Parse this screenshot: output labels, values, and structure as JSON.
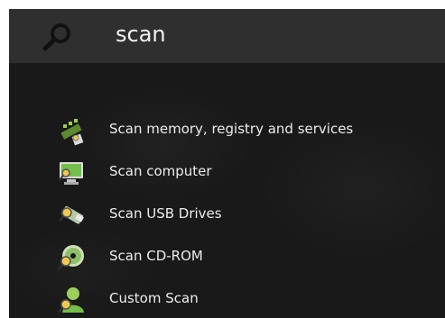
{
  "search": {
    "query": "scan",
    "icon": "search-icon"
  },
  "results": [
    {
      "label": "Scan memory, registry and services",
      "icon": "memory-chip-icon"
    },
    {
      "label": "Scan computer",
      "icon": "monitor-icon"
    },
    {
      "label": "Scan USB Drives",
      "icon": "usb-drive-icon"
    },
    {
      "label": "Scan CD-ROM",
      "icon": "cd-rom-icon"
    },
    {
      "label": "Custom Scan",
      "icon": "user-icon"
    }
  ],
  "colors": {
    "background": "#191919",
    "search_bar": "#2f2f2f",
    "text": "#ececec",
    "magnifier": "#f2c94c"
  }
}
